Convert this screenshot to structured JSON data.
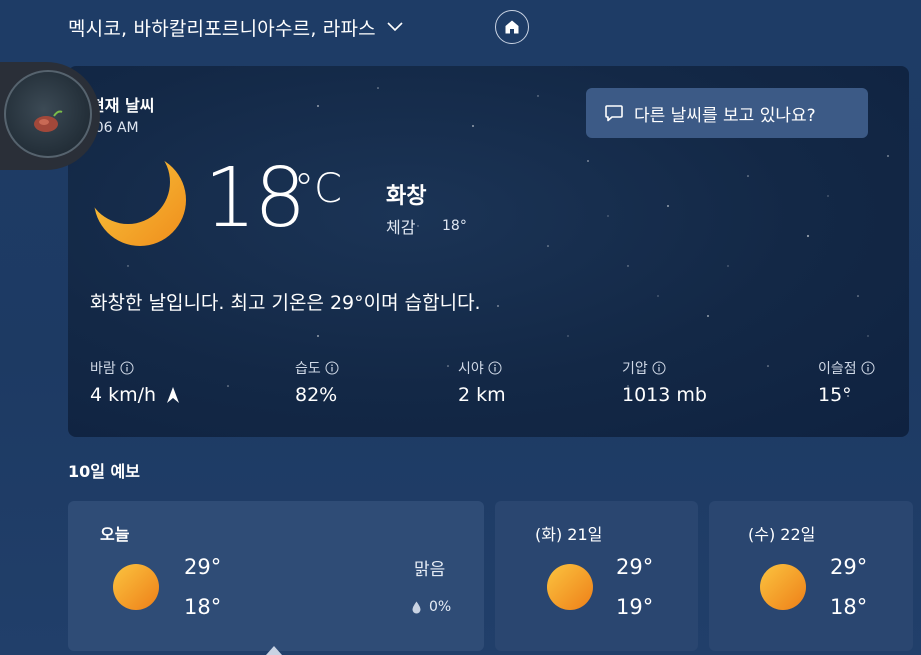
{
  "header": {
    "location": "멕시코, 바하칼리포르니아수르, 라파스",
    "chevron_icon": "chevron-down-icon",
    "home_icon": "home-icon"
  },
  "current": {
    "title": "현재 날씨",
    "time": ":06 AM",
    "feedback_label": "다른 날씨를 보고 있나요?",
    "feedback_icon": "chat-icon",
    "weather_icon": "moon-icon",
    "temperature": "18",
    "unit": "°C",
    "condition": "화창",
    "feels_like_label": "체감",
    "feels_like_value": "18°",
    "summary": "화창한 날입니다. 최고 기온은 29°이며 습합니다.",
    "metrics": [
      {
        "label": "바람",
        "value": "4 km/h"
      },
      {
        "label": "습도",
        "value": "82%"
      },
      {
        "label": "시야",
        "value": "2 km"
      },
      {
        "label": "기압",
        "value": "1013 mb"
      },
      {
        "label": "이슬점",
        "value": "15°"
      }
    ]
  },
  "forecast": {
    "title": "10일 예보",
    "days": [
      {
        "name": "오늘",
        "high": "29°",
        "low": "18°",
        "condition": "맑음",
        "precip": "0%",
        "icon": "sun-icon"
      },
      {
        "name": "(화) 21일",
        "high": "29°",
        "low": "19°",
        "icon": "sun-icon"
      },
      {
        "name": "(수) 22일",
        "high": "29°",
        "low": "18°",
        "icon": "sun-icon"
      }
    ]
  },
  "colors": {
    "background": "#1e3c66",
    "card": "#132846",
    "button": "#3c5a86",
    "sun": "#f5a623",
    "moon": "#f4b12c"
  }
}
